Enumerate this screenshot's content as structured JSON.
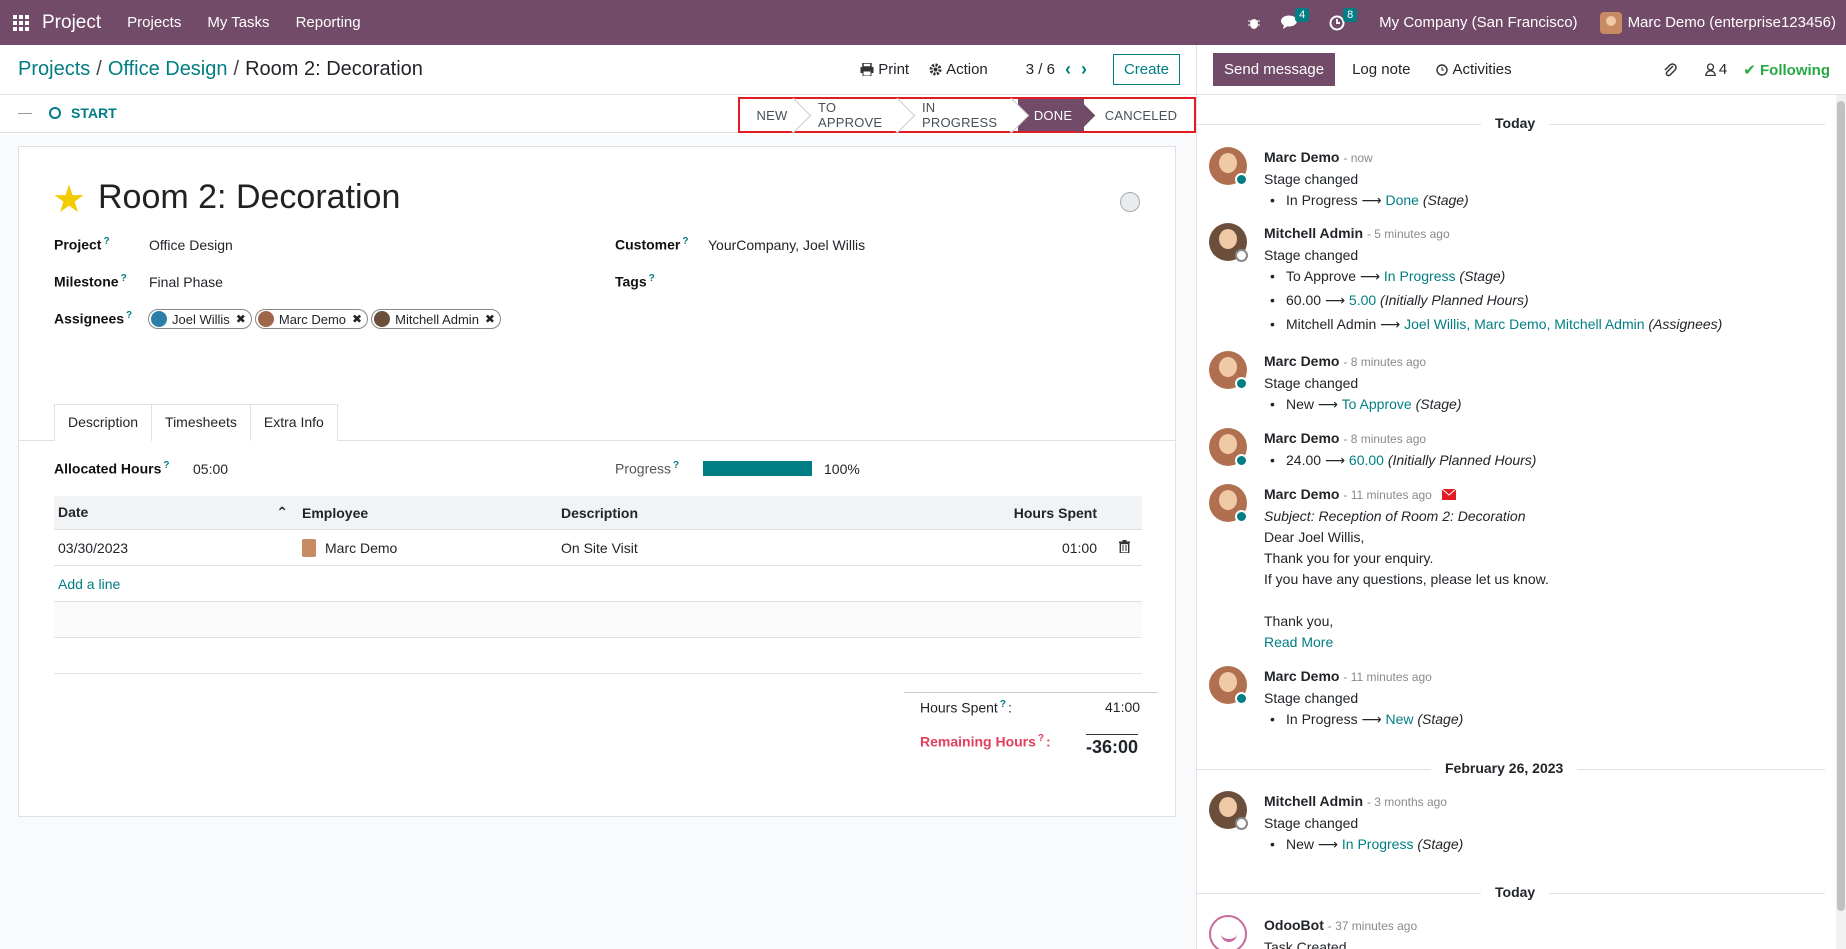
{
  "navbar": {
    "app_name": "Project",
    "menu": [
      "Projects",
      "My Tasks",
      "Reporting"
    ],
    "messages_count": "4",
    "activities_count": "8",
    "company": "My Company (San Francisco)",
    "user": "Marc Demo (enterprise123456)"
  },
  "breadcrumb": {
    "root": "Projects",
    "project": "Office Design",
    "current": "Room 2: Decoration"
  },
  "controls": {
    "print": "Print",
    "action": "Action",
    "pager": "3 / 6",
    "create": "Create"
  },
  "statusbar": {
    "start": "START",
    "stages": [
      "NEW",
      "TO APPROVE",
      "IN PROGRESS",
      "DONE",
      "CANCELED"
    ],
    "active_stage": "DONE"
  },
  "task": {
    "title": "Room 2: Decoration",
    "starred": true,
    "project_label": "Project",
    "project": "Office Design",
    "milestone_label": "Milestone",
    "milestone": "Final Phase",
    "assignees_label": "Assignees",
    "assignees": [
      "Joel Willis",
      "Marc Demo",
      "Mitchell Admin"
    ],
    "customer_label": "Customer",
    "customer": "YourCompany, Joel Willis",
    "tags_label": "Tags",
    "help_mark": "?"
  },
  "tabs": [
    "Description",
    "Timesheets",
    "Extra Info"
  ],
  "timesheets": {
    "allocated_label": "Allocated Hours",
    "allocated": "05:00",
    "progress_label": "Progress",
    "progress_text": "100%",
    "progress": 1.0,
    "columns": [
      "Date",
      "Employee",
      "Description",
      "Hours Spent"
    ],
    "rows": [
      {
        "date": "03/30/2023",
        "employee": "Marc Demo",
        "description": "On Site Visit",
        "hours": "01:00"
      }
    ],
    "add_line": "Add a line",
    "hours_spent_label": "Hours Spent",
    "hours_spent": "41:00",
    "remaining_label": "Remaining Hours",
    "remaining": "-36:00",
    "colon": ":"
  },
  "chatter": {
    "send_message": "Send message",
    "log_note": "Log note",
    "activities": "Activities",
    "followers_count": "4",
    "following": "Following",
    "date_today": "Today",
    "date_feb": "February 26, 2023",
    "arrow": "⟶",
    "messages": [
      {
        "author": "Marc Demo",
        "time": "- now",
        "text": "Stage changed",
        "changes": [
          {
            "from": "In Progress",
            "to": "Done",
            "field": "(Stage)"
          }
        ]
      },
      {
        "author": "Mitchell Admin",
        "time": "- 5 minutes ago",
        "text": "Stage changed",
        "changes": [
          {
            "from": "To Approve",
            "to": "In Progress",
            "field": "(Stage)"
          },
          {
            "from": "60.00",
            "to": "5.00",
            "field": "(Initially Planned Hours)"
          },
          {
            "from": "Mitchell Admin",
            "to": "Joel Willis, Marc Demo, Mitchell Admin",
            "field": "(Assignees)"
          }
        ]
      },
      {
        "author": "Marc Demo",
        "time": "- 8 minutes ago",
        "text": "Stage changed",
        "changes": [
          {
            "from": "New",
            "to": "To Approve",
            "field": "(Stage)"
          }
        ]
      },
      {
        "author": "Marc Demo",
        "time": "- 8 minutes ago",
        "changes": [
          {
            "from": "24.00",
            "to": "60.00",
            "field": "(Initially Planned Hours)"
          }
        ]
      },
      {
        "author": "Marc Demo",
        "time": "- 11 minutes ago",
        "subject": "Subject: Reception of Room 2: Decoration",
        "lines": [
          "Dear Joel Willis,",
          "Thank you for your enquiry.",
          "If you have any questions, please let us know.",
          "Thank you,"
        ],
        "read_more": "Read More"
      },
      {
        "author": "Marc Demo",
        "time": "- 11 minutes ago",
        "text": "Stage changed",
        "changes": [
          {
            "from": "In Progress",
            "to": "New",
            "field": "(Stage)"
          }
        ]
      },
      {
        "author": "Mitchell Admin",
        "time": "- 3 months ago",
        "text": "Stage changed",
        "changes": [
          {
            "from": "New",
            "to": "In Progress",
            "field": "(Stage)"
          }
        ]
      },
      {
        "author": "OdooBot",
        "time": "- 37 minutes ago",
        "text": "Task Created"
      }
    ]
  },
  "colors": {
    "brand": "#714B67",
    "accent": "#017e84",
    "danger": "#e0405e",
    "star": "#f3cc00"
  },
  "icons": [
    "apps-grid-icon",
    "bug-icon",
    "chat-icon",
    "clock-icon",
    "print-icon",
    "gear-icon",
    "paperclip-icon",
    "user-icon",
    "check-icon",
    "trash-icon",
    "envelope-icon"
  ]
}
